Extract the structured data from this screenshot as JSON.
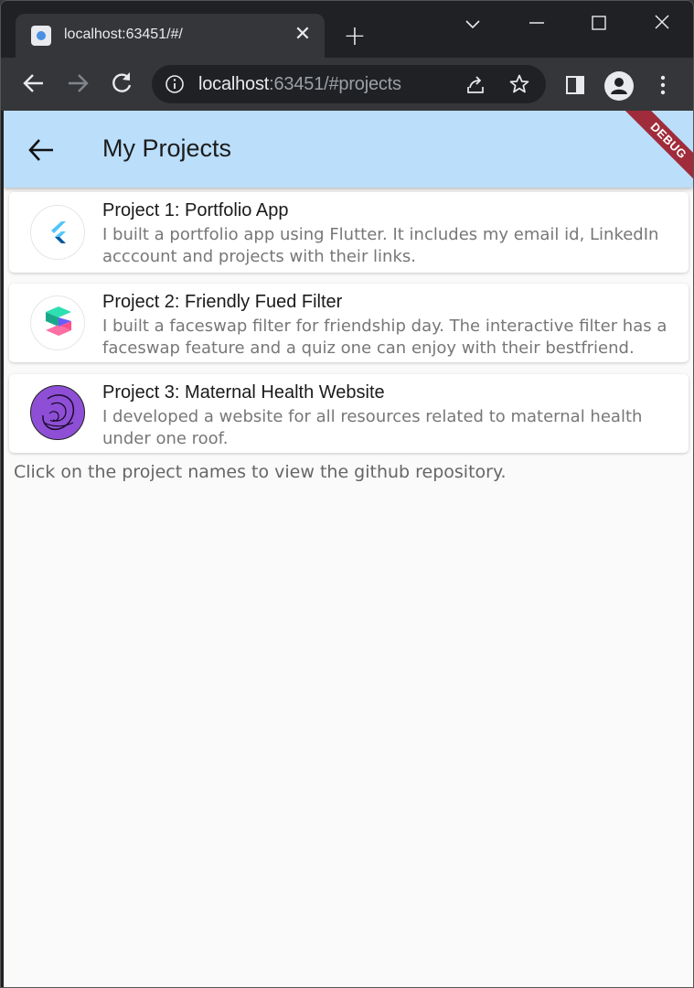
{
  "browser": {
    "tab_title": "localhost:63451/#/",
    "url_host": "localhost",
    "url_rest": ":63451/#projects"
  },
  "app": {
    "title": "My Projects",
    "debug_banner": "DEBUG",
    "appbar_color": "#bbdefb"
  },
  "projects": [
    {
      "title": "Project 1: Portfolio App",
      "description": "I built a portfolio app using Flutter. It includes my email id, LinkedIn acccount and projects with their links.",
      "icon": "flutter-logo-icon"
    },
    {
      "title": "Project 2: Friendly Fued Filter",
      "description": "I built a faceswap filter for friendship day. The interactive filter has a faceswap feature and a quiz one can enjoy with their bestfriend.",
      "icon": "spark-ar-logo-icon"
    },
    {
      "title": "Project 3: Maternal Health Website",
      "description": "I developed a website for all resources related to maternal health under one roof.",
      "icon": "maternal-health-logo-icon"
    }
  ],
  "hint": "Click on the project names to view the github repository."
}
